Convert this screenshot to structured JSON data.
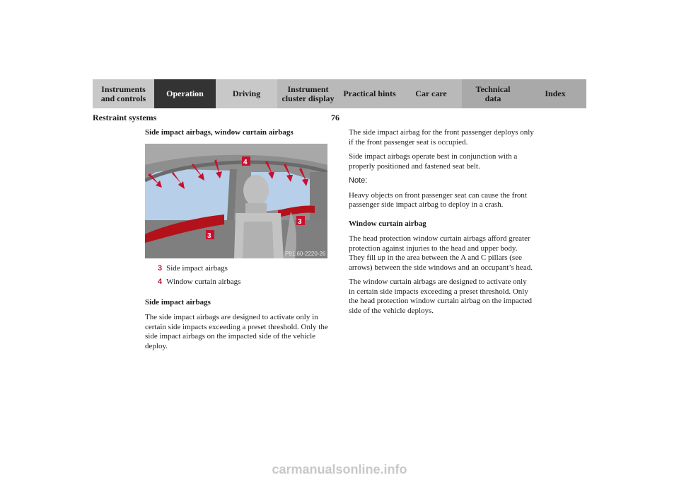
{
  "nav": {
    "tabs": [
      {
        "label": "Instruments\nand controls",
        "active": false
      },
      {
        "label": "Operation",
        "active": true
      },
      {
        "label": "Driving",
        "active": false
      },
      {
        "label": "Instrument\ncluster display",
        "active": false
      },
      {
        "label": "Practical hints",
        "active": false
      },
      {
        "label": "Car care",
        "active": false
      },
      {
        "label": "Technical\ndata",
        "active": false
      },
      {
        "label": "Index",
        "active": false
      }
    ]
  },
  "header": {
    "section_title": "Restraint systems",
    "page_number": "76"
  },
  "left": {
    "heading": "Side impact airbags, window curtain airbags",
    "figure": {
      "code": "P91.60-2220-26",
      "callout_3": "3",
      "callout_4": "4"
    },
    "legend": [
      {
        "num": "3",
        "text": "Side impact airbags"
      },
      {
        "num": "4",
        "text": "Window curtain airbags"
      }
    ],
    "sub_heading": "Side impact airbags",
    "paragraph": "The side impact airbags are designed to activate only in certain side impacts exceeding a preset threshold. Only the side impact airbags on the impacted side of the vehicle deploy."
  },
  "right": {
    "p1": "The side impact airbag for the front passenger deploys only if the front passenger seat is occupied.",
    "p2": "Side impact airbags operate best in conjunction with a properly positioned and fastened seat belt.",
    "note_label": "Note:",
    "note_text": "Heavy objects on front passenger seat can cause the front passenger side impact airbag to deploy in a crash.",
    "sub_heading": "Window curtain airbag",
    "p3": "The head protection window curtain airbags afford greater protection against injuries to the head and upper body. They fill up in the area between the A and C pillars (see arrows) between the side windows and an occupant’s head.",
    "p4": "The window curtain airbags are designed to activate only in certain side impacts exceeding a preset threshold. Only the head protection window curtain airbag on the impacted side of the vehicle deploys."
  },
  "watermark": "carmanualsonline.info",
  "colors": {
    "accent": "#c8102e",
    "active_tab": "#333333"
  }
}
